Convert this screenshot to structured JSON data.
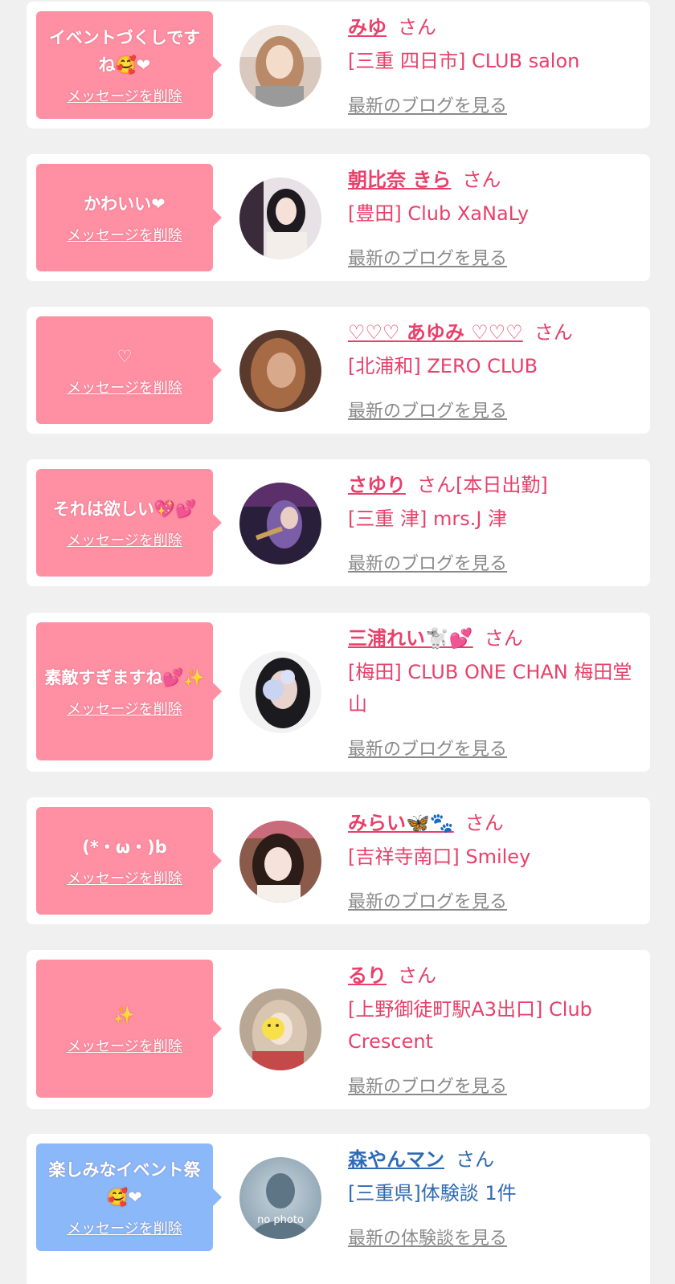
{
  "colors": {
    "card_bg": "#ffffff",
    "page_bg": "#f0f0f0",
    "bubble_pink": "#ff8fa3",
    "bubble_blue": "#8ab8f8",
    "name_pink": "#e8406a",
    "name_blue": "#2f6ab5",
    "link_gray": "#8a8a8a"
  },
  "entries": [
    {
      "message": "イベントづくしですね🥰❤",
      "delete_label": "メッセージを削除",
      "name": "みゆ",
      "honorific": "さん",
      "shop": "[三重 四日市] CLUB salon",
      "blog_link": "最新のブログを見る",
      "avatar": "photo-avatar"
    },
    {
      "message": "かわいい❤",
      "delete_label": "メッセージを削除",
      "name": "朝比奈 きら",
      "honorific": "さん",
      "shop": "[豊田] Club XaNaLy",
      "blog_link": "最新のブログを見る",
      "avatar": "photo-avatar"
    },
    {
      "message": "♡",
      "delete_label": "メッセージを削除",
      "name": "♡♡♡ あゆみ ♡♡♡",
      "honorific": "さん",
      "shop": "[北浦和] ZERO CLUB",
      "blog_link": "最新のブログを見る",
      "avatar": "photo-avatar"
    },
    {
      "message": "それは欲しい💖💕",
      "delete_label": "メッセージを削除",
      "name": "さゆり",
      "honorific": "さん[本日出勤]",
      "shop": "[三重 津] mrs.J 津",
      "blog_link": "最新のブログを見る",
      "avatar": "photo-avatar"
    },
    {
      "message": "素敵すぎますね💕✨",
      "delete_label": "メッセージを削除",
      "name": "三浦れい🐩💕",
      "honorific": "さん",
      "shop": "[梅田] CLUB ONE CHAN 梅田堂山",
      "blog_link": "最新のブログを見る",
      "avatar": "photo-avatar"
    },
    {
      "message": "(*・ω・)b",
      "delete_label": "メッセージを削除",
      "name": "みらい🦋🐾",
      "honorific": "さん",
      "shop": "[吉祥寺南口] Smiley",
      "blog_link": "最新のブログを見る",
      "avatar": "photo-avatar"
    },
    {
      "message": "✨",
      "delete_label": "メッセージを削除",
      "name": "るり",
      "honorific": "さん",
      "shop": "[上野御徒町駅A3出口] Club Crescent",
      "blog_link": "最新のブログを見る",
      "avatar": "photo-avatar"
    },
    {
      "message": "楽しみなイベント祭🥰❤",
      "delete_label": "メッセージを削除",
      "name": "森やんマン",
      "honorific": "さん",
      "shop": "[三重県]体験談 1件",
      "blog_link": "最新の体験談を見る",
      "avatar": "no-photo-avatar",
      "avatar_text": "no photo"
    }
  ]
}
